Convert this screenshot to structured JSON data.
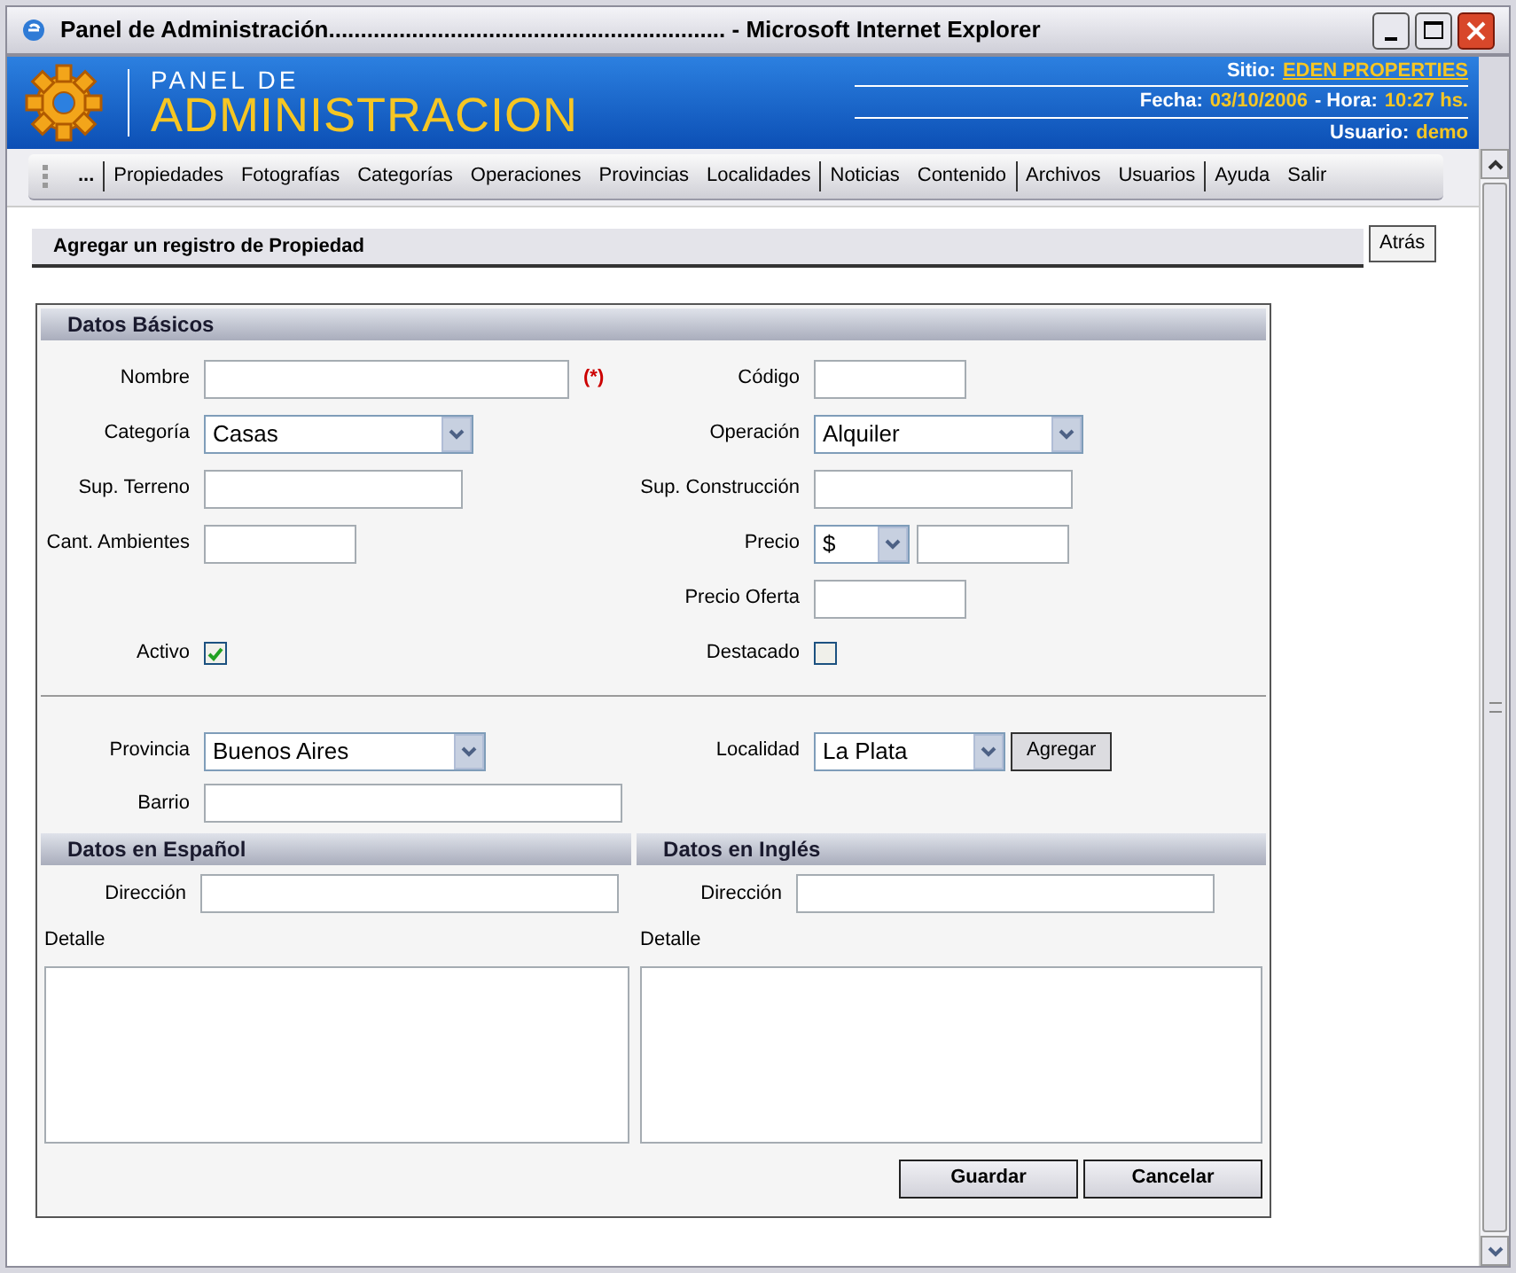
{
  "window": {
    "title": "Panel de Administración.............................................................. - Microsoft Internet Explorer"
  },
  "header": {
    "logo_line_1": "PANEL DE",
    "logo_line_2": "ADMINISTRACION",
    "site_label": "Sitio:",
    "site": "EDEN PROPERTIES",
    "date_label": "Fecha:",
    "date": "03/10/2006",
    "time_label": "- Hora:",
    "time": "10:27 hs.",
    "user_label": "Usuario:",
    "user": "demo"
  },
  "menu": {
    "groups": [
      [
        "..."
      ],
      [
        "Propiedades",
        "Fotografías",
        "Categorías",
        "Operaciones",
        "Provincias",
        "Localidades"
      ],
      [
        "Noticias",
        "Contenido"
      ],
      [
        "Archivos",
        "Usuarios"
      ],
      [
        "Ayuda",
        "Salir"
      ]
    ]
  },
  "page_heading": "Agregar un registro de Propiedad",
  "back_button": "Atrás",
  "basic": {
    "title": "Datos Básicos",
    "rows": [
      {
        "left": {
          "label": "Nombre",
          "kind": "text",
          "required_mark": "(*)"
        },
        "right": {
          "label": "Código",
          "kind": "text"
        }
      },
      {
        "left": {
          "label": "Categoría",
          "kind": "select",
          "value": "Casas"
        },
        "right": {
          "label": "Operación",
          "kind": "select",
          "value": "Alquiler"
        }
      },
      {
        "left": {
          "label": "Sup. Terreno",
          "kind": "text"
        },
        "right": {
          "label": "Sup. Construcción",
          "kind": "text"
        }
      },
      {
        "left": {
          "label": "Cant. Ambientes",
          "kind": "text"
        },
        "right": {
          "label": "Precio",
          "kind": "price",
          "currency": "$"
        }
      },
      {
        "right": {
          "label": "Precio Oferta",
          "kind": "text"
        }
      },
      {
        "left": {
          "label": "Activo",
          "kind": "checkbox",
          "checked": true
        },
        "right": {
          "label": "Destacado",
          "kind": "checkbox",
          "checked": false
        }
      }
    ]
  },
  "location": {
    "province_label": "Provincia",
    "province": "Buenos Aires",
    "locality_label": "Localidad",
    "locality": "La Plata",
    "add_button": "Agregar",
    "neighborhood_label": "Barrio"
  },
  "languages": [
    {
      "title": "Datos en Español",
      "address_label": "Dirección",
      "detail_label": "Detalle"
    },
    {
      "title": "Datos en Inglés",
      "address_label": "Dirección",
      "detail_label": "Detalle"
    }
  ],
  "buttons": [
    "Guardar",
    "Cancelar"
  ]
}
